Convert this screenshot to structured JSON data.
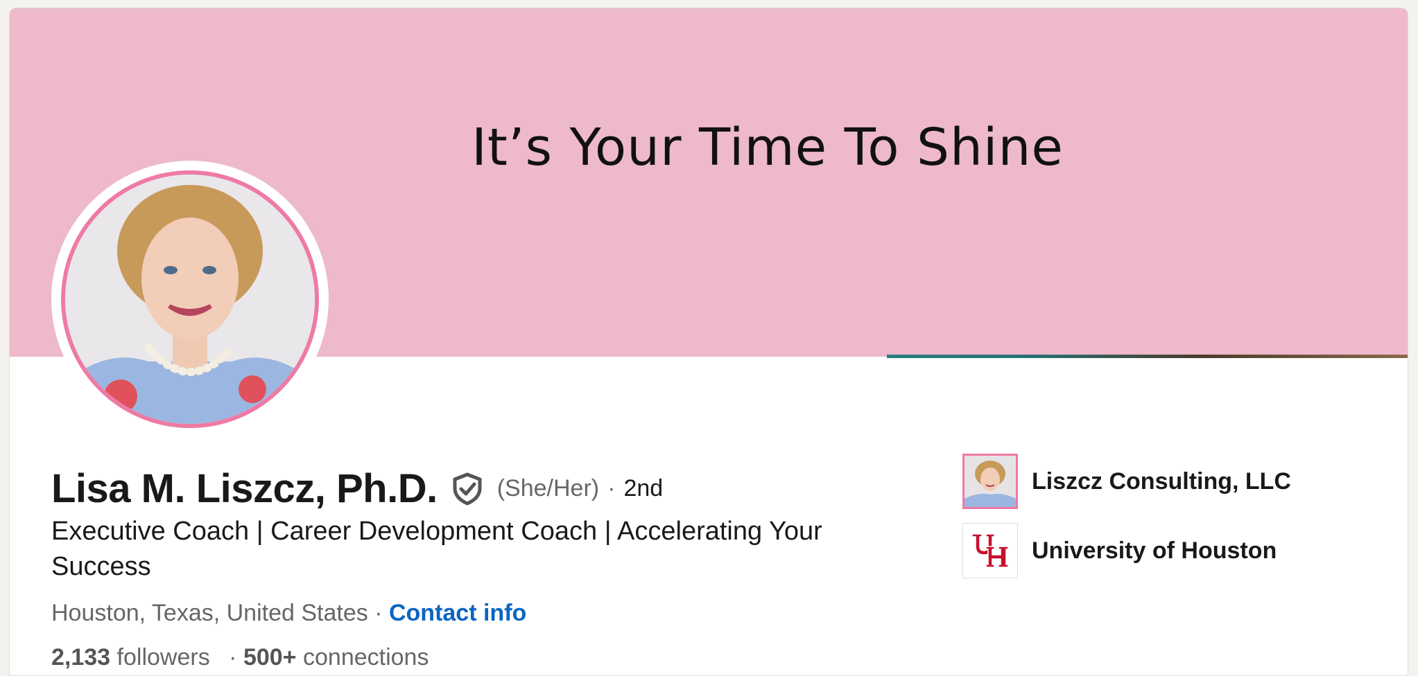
{
  "banner": {
    "title": "It’s Your Time To Shine",
    "background": "#edb9cb"
  },
  "profile": {
    "name": "Lisa M. Liszcz, Ph.D.",
    "pronouns": "(She/Her)",
    "degree_separator": "·",
    "connection_degree": "2nd",
    "headline": "Executive Coach | Career Development Coach | Accelerating Your Success",
    "location": "Houston, Texas, United States",
    "location_separator": "·",
    "contact_info_label": "Contact info",
    "followers_count": "2,133",
    "followers_label": "followers",
    "stats_separator": "·",
    "connections_count": "500+",
    "connections_label": "connections"
  },
  "organizations": [
    {
      "name": "Liszcz Consulting, LLC",
      "icon": "consulting-logo-photo"
    },
    {
      "name": "University of Houston",
      "icon": "university-of-houston-logo"
    }
  ],
  "colors": {
    "accent_link": "#0a66c2",
    "avatar_ring": "#ee7aa5",
    "uh_red": "#c8102e"
  }
}
